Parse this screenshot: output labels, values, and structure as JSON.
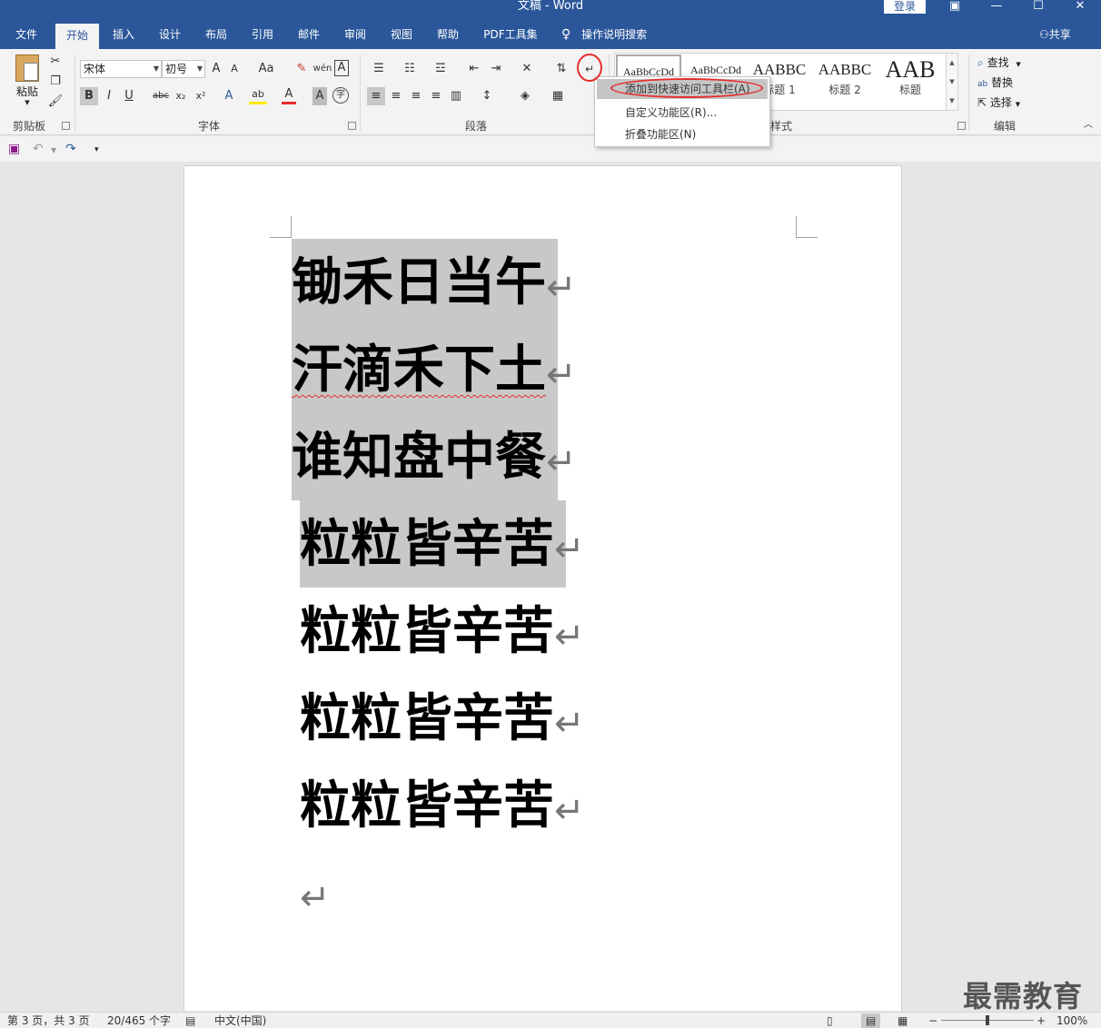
{
  "window": {
    "title": "文稿  -  Word",
    "login": "登录"
  },
  "tabs": [
    "文件",
    "开始",
    "插入",
    "设计",
    "布局",
    "引用",
    "邮件",
    "审阅",
    "视图",
    "帮助",
    "PDF工具集"
  ],
  "tell_me": "操作说明搜索",
  "share": "共享",
  "ribbon": {
    "clipboard": {
      "paste": "粘贴",
      "label": "剪贴板"
    },
    "font": {
      "family": "宋体",
      "size": "初号",
      "label": "字体",
      "bold": "B",
      "italic": "I",
      "underline": "U",
      "strike": "abc",
      "sub": "x₂",
      "sup": "x²",
      "grow": "A",
      "shrink": "A",
      "case": "Aa",
      "phonetic": "wén",
      "border_char": "A",
      "effects": "A",
      "highlight": "ab",
      "color": "A",
      "shade": "A",
      "enclose": "字"
    },
    "paragraph": {
      "label": "段落"
    },
    "styles": {
      "label": "样式",
      "items": [
        {
          "sample": "AaBbCcDd",
          "name": ""
        },
        {
          "sample": "AaBbCcDd",
          "name": ""
        },
        {
          "sample": "AABBC",
          "name": "标题 1"
        },
        {
          "sample": "AABBC",
          "name": "标题 2"
        },
        {
          "sample": "AAB",
          "name": "标题"
        }
      ]
    },
    "editing": {
      "label": "编辑",
      "find": "查找",
      "replace": "替换",
      "select": "选择"
    }
  },
  "context_menu": [
    {
      "label": "添加到快速访问工具栏(A)",
      "highlighted": true
    },
    {
      "label": "自定义功能区(R)...",
      "highlighted": false
    },
    {
      "label": "折叠功能区(N)",
      "highlighted": false
    }
  ],
  "document": {
    "lines": [
      "锄禾日当午",
      "汗滴禾下土",
      "谁知盘中餐",
      "粒粒皆辛苦",
      "粒粒皆辛苦",
      "粒粒皆辛苦",
      "粒粒皆辛苦"
    ],
    "paragraph_mark": "↵"
  },
  "watermark": "最需教育",
  "status": {
    "page": "第 3 页，共 3 页",
    "words": "20/465 个字",
    "lang": "中文(中国)",
    "zoom": "100%"
  },
  "colors": {
    "brand": "#2b579a",
    "callout": "#e52d2d",
    "selection": "#c8c8c8"
  }
}
